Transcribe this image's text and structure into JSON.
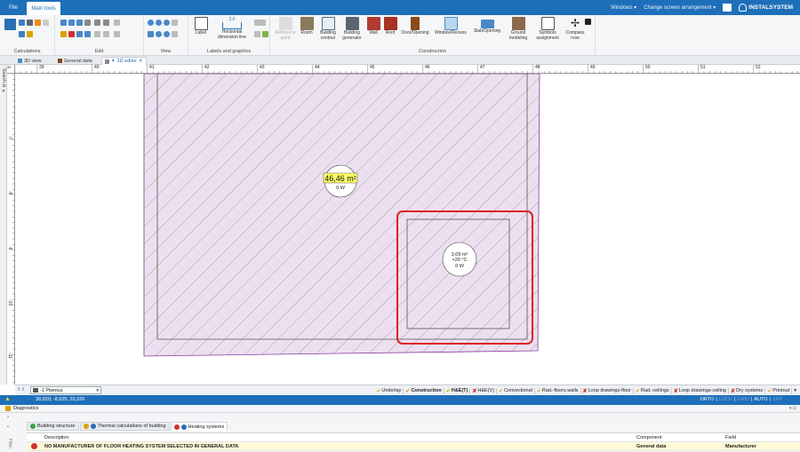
{
  "tabs": {
    "file": "File",
    "main_tools": "Main tools"
  },
  "titlebar": {
    "windows": "Windows",
    "arrangement": "Change screen arrangement",
    "brand": "INSTALSYSTEM"
  },
  "ribbon": {
    "groups": {
      "calculations": "Calculations",
      "edit": "Edit",
      "view": "View",
      "labels_graphics": "Labels and graphics",
      "construction": "Construction"
    },
    "buttons": {
      "label": "Label",
      "horizontal_dimension_line": "Horizontal dimension line",
      "reference_point": "Reference point",
      "room": "Room",
      "building_contour": "Building contour",
      "building_generator": "Building generator",
      "wall": "Wall",
      "roof": "Roof",
      "door_opening": "Door/Opening",
      "window_recess": "Window/Recess",
      "slab_opening": "Slab/Opening",
      "ground_modeling": "Ground modeling",
      "symbols_assignment": "Symbols assignment",
      "compass_rose": "Compass rose",
      "dim_sample": "2,0"
    }
  },
  "doc_tabs": [
    "3D view",
    "General data",
    "2D editor"
  ],
  "side_strip": "Search",
  "ruler": {
    "h": [
      "39",
      "40",
      "41",
      "42",
      "43",
      "44",
      "45",
      "46",
      "47",
      "48",
      "49",
      "50",
      "51",
      "52"
    ],
    "v": [
      "-7",
      "-8",
      "-9",
      "-10",
      "-11"
    ],
    "corner": "30"
  },
  "drawing": {
    "room_main": {
      "area": "46,46 m²",
      "power": "0 W"
    },
    "room_small": {
      "area": "3,09 m²",
      "temp": "+20 °C",
      "power": "0 W"
    },
    "colors": {
      "room_fill": "#ece0f0",
      "room_border": "#8a3a9b",
      "hatch": "#777777",
      "highlight": "#dd2222",
      "label_bg": "#ffff66"
    }
  },
  "floor": {
    "name": "-1  Piwnica"
  },
  "layers": [
    "Underlay",
    "Construction",
    "H&E(T)",
    "H&E(V)",
    "Convectional",
    "Rad.-floors,walls",
    "Loop drawings-floor",
    "Rad.-ceilings",
    "Loop drawings-ceiling",
    "Dry systems",
    "Printout"
  ],
  "status": {
    "coords": "38,820; -8,925; 20,326",
    "modes": [
      "ORTO",
      "LOCK",
      "GRID",
      "AUTO",
      "SEP"
    ]
  },
  "diagnostics": {
    "title": "Diagnostics",
    "tabs": [
      "Building structure",
      "Thermal calculations of building",
      "Heating systems"
    ],
    "columns": {
      "description": "Description",
      "component": "Component",
      "field": "Field"
    },
    "rows": [
      {
        "description": "NO MANUFACTURER OF FLOOR HEATING SYSTEM SELECTED IN GENERAL DATA",
        "component": "General data",
        "field": "Manufacturer"
      }
    ],
    "filters": "Filter"
  }
}
